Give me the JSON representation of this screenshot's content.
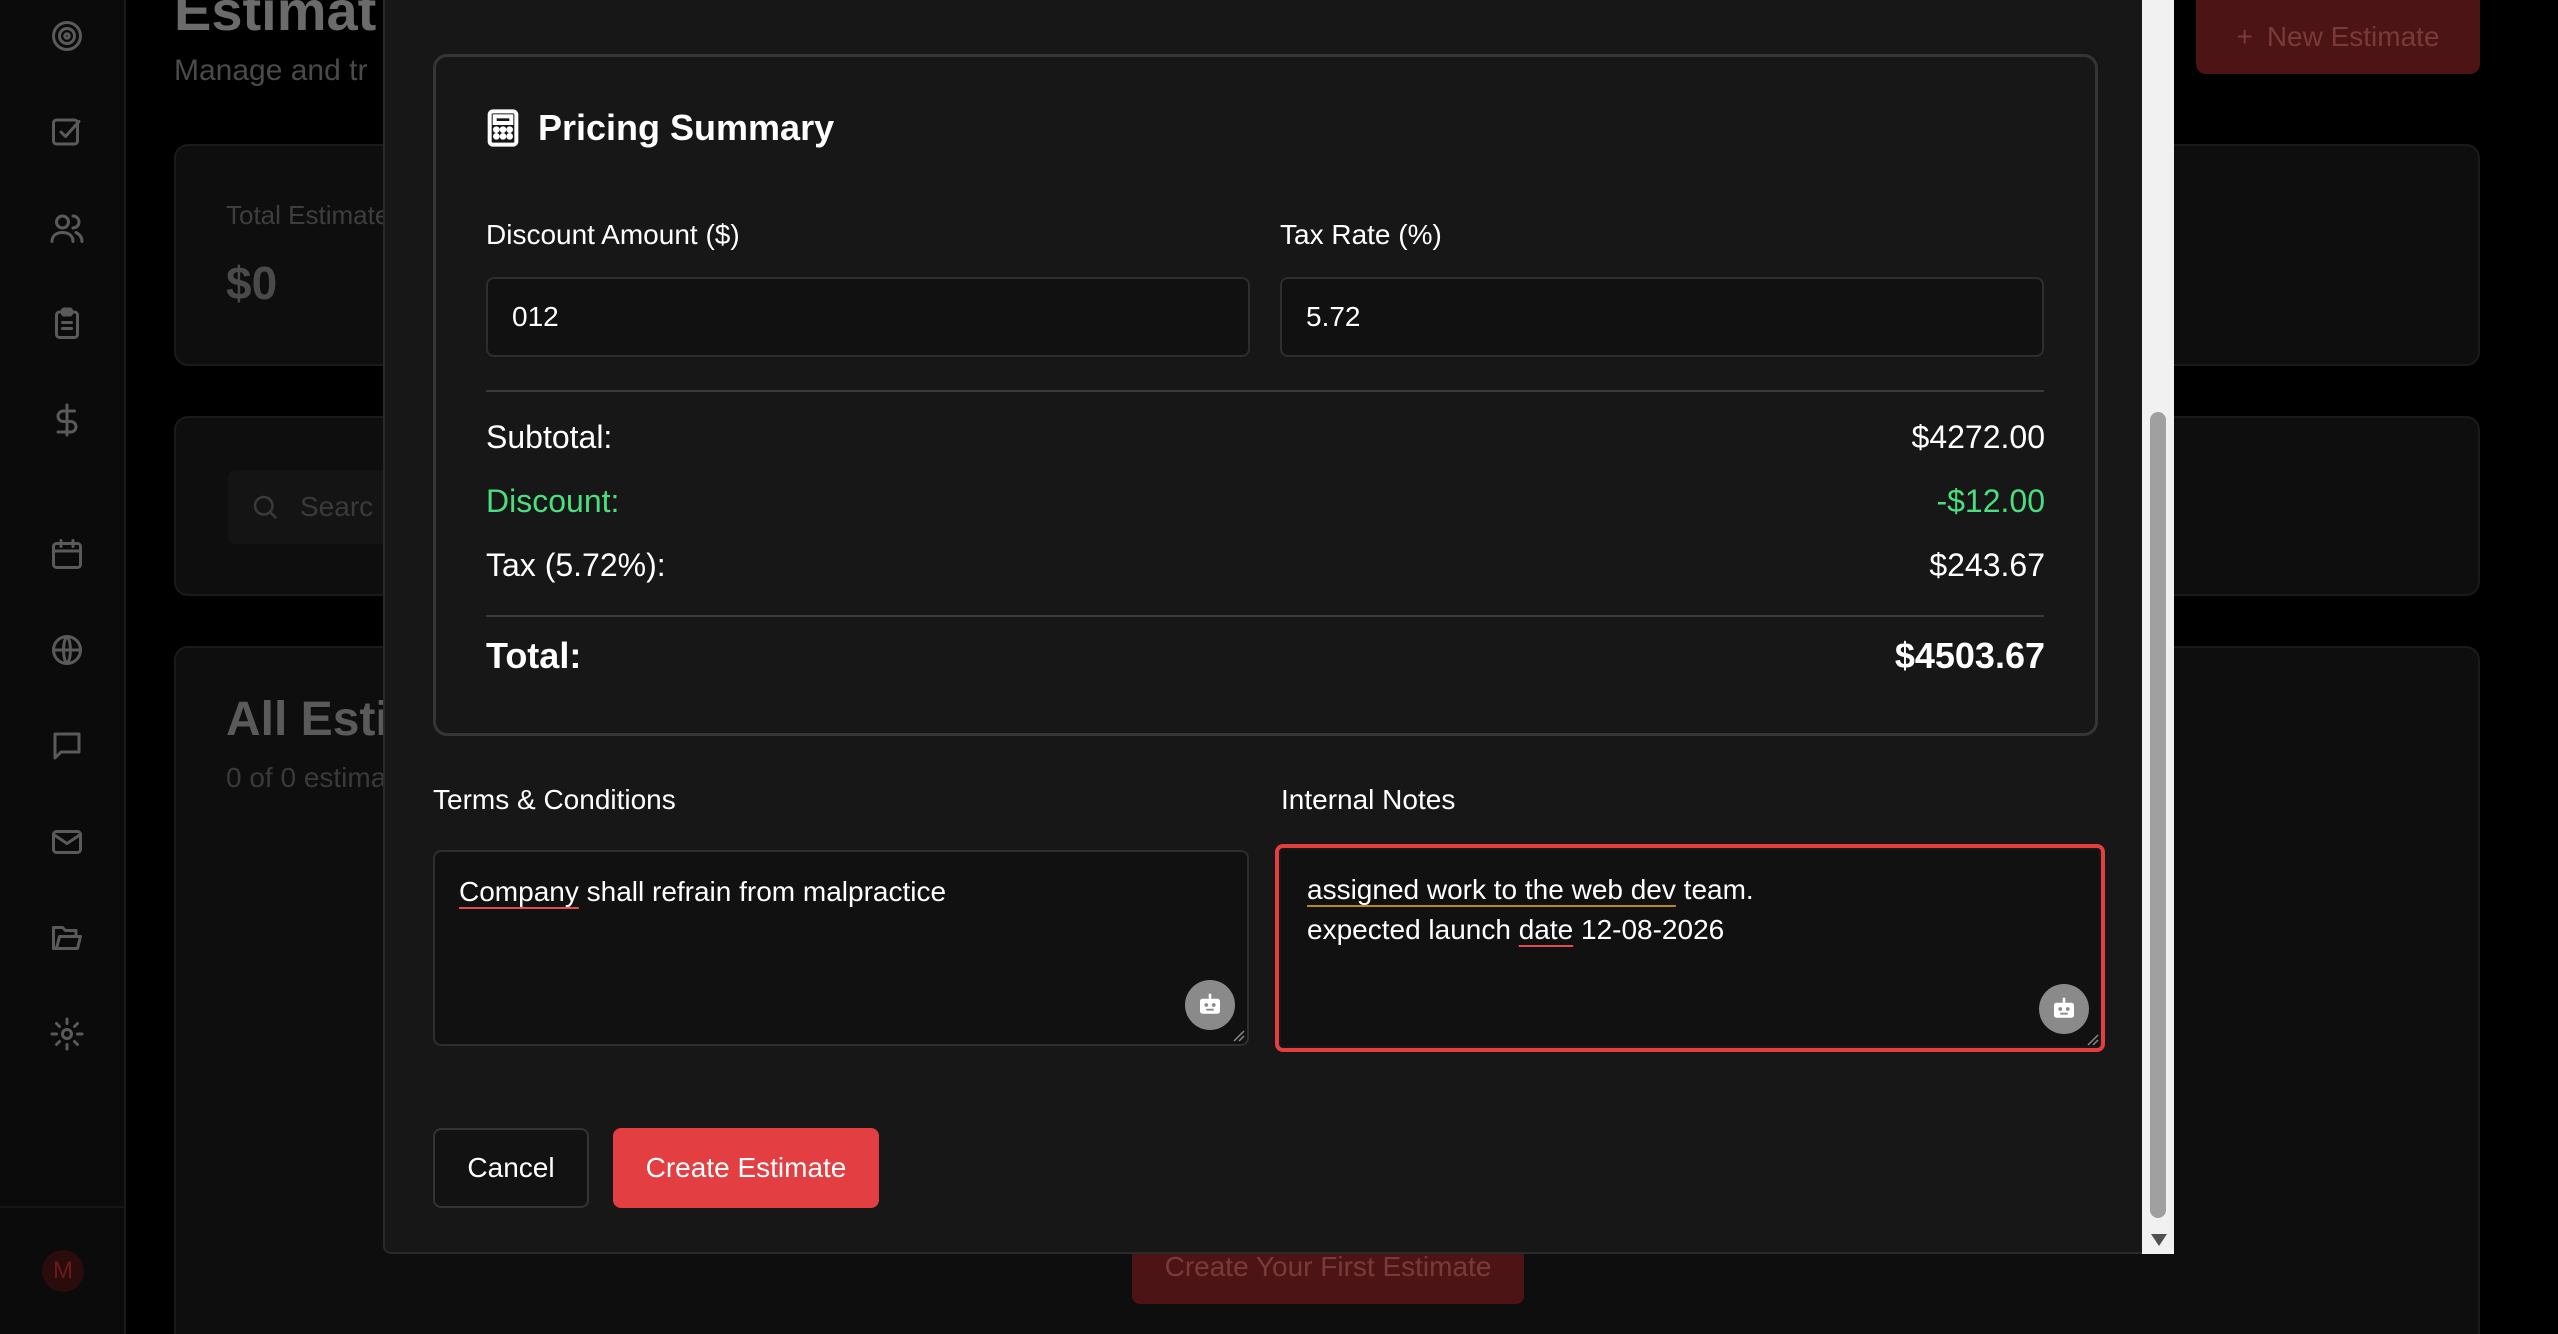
{
  "background": {
    "page_title": "Estimat",
    "page_subtitle": "Manage and tr",
    "new_estimate_label": "New Estimate",
    "stat_label": "Total Estimate",
    "stat_value": "$0",
    "search_placeholder": "Searc",
    "all_title": "All Esti",
    "all_subtitle": "0 of 0 estima",
    "first_estimate_label": "Create Your First Estimate",
    "avatar_initial": "M",
    "sidebar_icons": [
      "target-icon",
      "checkbox-icon",
      "users-icon",
      "clipboard-icon",
      "dollar-icon",
      "calendar-icon",
      "globe-icon",
      "chat-icon",
      "mail-icon",
      "folder-icon",
      "gear-icon"
    ]
  },
  "modal": {
    "pricing": {
      "title": "Pricing Summary",
      "discount_label": "Discount Amount ($)",
      "discount_value": "012",
      "tax_label": "Tax Rate (%)",
      "tax_value": "5.72",
      "subtotal_label": "Subtotal:",
      "subtotal_value": "$4272.00",
      "discount_row_label": "Discount:",
      "discount_row_value": "-$12.00",
      "tax_row_label": "Tax (5.72%):",
      "tax_row_value": "$243.67",
      "total_label": "Total:",
      "total_value": "$4503.67"
    },
    "terms": {
      "label": "Terms & Conditions",
      "word_underlined": "Company",
      "rest": " shall refrain from malpractice"
    },
    "notes": {
      "label": "Internal Notes",
      "line1_underlined": "assigned work to the web dev",
      "line1_rest": " team.",
      "line2_pre": "expected launch ",
      "line2_underlined": "date",
      "line2_rest": " 12-08-2026"
    },
    "cancel_label": "Cancel",
    "create_label": "Create Estimate"
  },
  "colors": {
    "accent": "#e33e42",
    "discount_green": "#4ade80",
    "focus_ring": "#e53e3e"
  }
}
